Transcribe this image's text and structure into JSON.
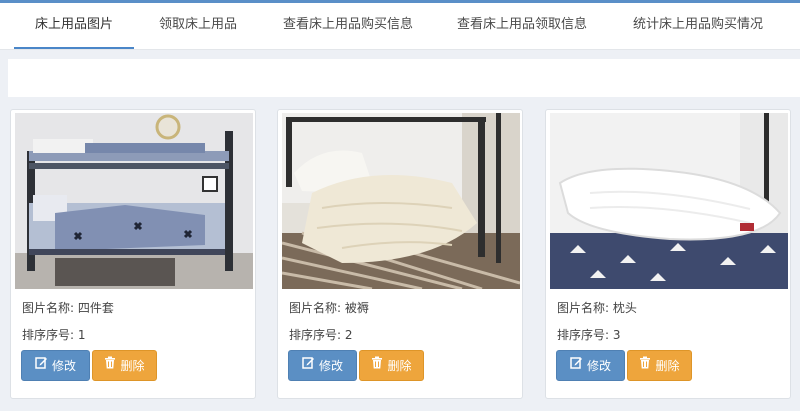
{
  "tabs": [
    {
      "label": "床上用品图片",
      "active": true
    },
    {
      "label": "领取床上用品",
      "active": false
    },
    {
      "label": "查看床上用品购买信息",
      "active": false
    },
    {
      "label": "查看床上用品领取信息",
      "active": false
    },
    {
      "label": "统计床上用品购买情况",
      "active": false
    }
  ],
  "cards": [
    {
      "name_label": "图片名称:",
      "name_value": "四件套",
      "order_label": "排序序号:",
      "order_value": "1",
      "edit_label": "修改",
      "delete_label": "删除"
    },
    {
      "name_label": "图片名称:",
      "name_value": "被褥",
      "order_label": "排序序号:",
      "order_value": "2",
      "edit_label": "修改",
      "delete_label": "删除"
    },
    {
      "name_label": "图片名称:",
      "name_value": "枕头",
      "order_label": "排序序号:",
      "order_value": "3",
      "edit_label": "修改",
      "delete_label": "删除"
    }
  ],
  "icons": {
    "edit": "edit-icon",
    "delete": "trash-icon"
  },
  "colors": {
    "accent": "#4a86c8",
    "edit_button": "#5b8fc4",
    "delete_button": "#eea53c",
    "page_bg": "#edf0f5"
  }
}
